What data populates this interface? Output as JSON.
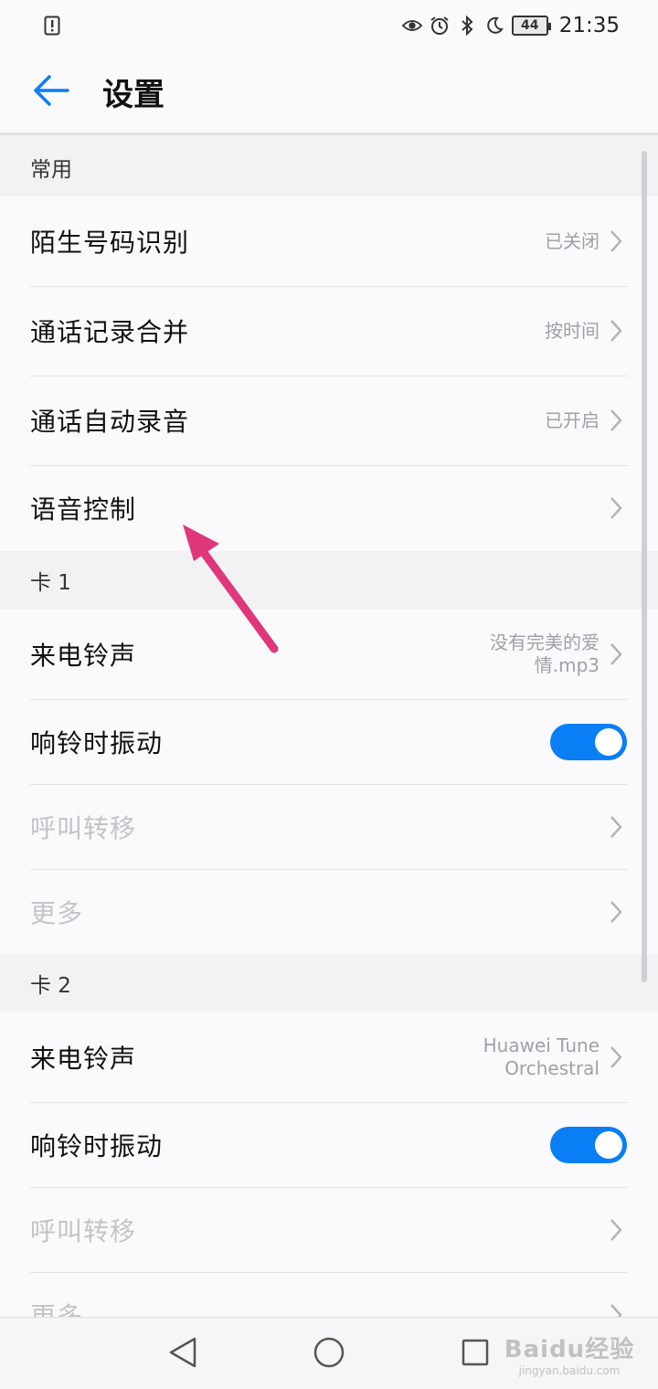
{
  "status_bar": {
    "battery": "44",
    "time": "21:35",
    "icons": [
      "sim-alert-icon",
      "eye-icon",
      "alarm-icon",
      "bluetooth-icon",
      "moon-icon",
      "battery-icon"
    ]
  },
  "header": {
    "back_icon": "arrow-left-icon",
    "title": "设置"
  },
  "sections": [
    {
      "title": "常用",
      "rows": [
        {
          "label": "陌生号码识别",
          "value": "已关闭",
          "type": "chevron",
          "enabled": true
        },
        {
          "label": "通话记录合并",
          "value": "按时间",
          "type": "chevron",
          "enabled": true
        },
        {
          "label": "通话自动录音",
          "value": "已开启",
          "type": "chevron",
          "enabled": true
        },
        {
          "label": "语音控制",
          "value": "",
          "type": "chevron",
          "enabled": true
        }
      ]
    },
    {
      "title": "卡 1",
      "rows": [
        {
          "label": "来电铃声",
          "value_lines": [
            "没有完美的爱",
            "情.mp3"
          ],
          "type": "chevron",
          "enabled": true
        },
        {
          "label": "响铃时振动",
          "type": "toggle",
          "on": true,
          "enabled": true
        },
        {
          "label": "呼叫转移",
          "type": "chevron",
          "enabled": false
        },
        {
          "label": "更多",
          "type": "chevron",
          "enabled": false
        }
      ]
    },
    {
      "title": "卡 2",
      "rows": [
        {
          "label": "来电铃声",
          "value_lines": [
            "Huawei Tune",
            "Orchestral"
          ],
          "type": "chevron",
          "enabled": true
        },
        {
          "label": "响铃时振动",
          "type": "toggle",
          "on": true,
          "enabled": true
        },
        {
          "label": "呼叫转移",
          "type": "chevron",
          "enabled": false
        },
        {
          "label": "更多",
          "type": "chevron",
          "enabled": false
        }
      ]
    }
  ],
  "nav_bar": {
    "icons": [
      "back-triangle-icon",
      "home-circle-icon",
      "recents-square-icon"
    ]
  },
  "watermark": {
    "main": "Baidu经验",
    "sub": "jingyan.baidu.com"
  },
  "colors": {
    "accent": "#0a7ef5",
    "annotation_arrow": "#e0377a",
    "background": "#f2f2f4",
    "card": "#fafafc"
  }
}
